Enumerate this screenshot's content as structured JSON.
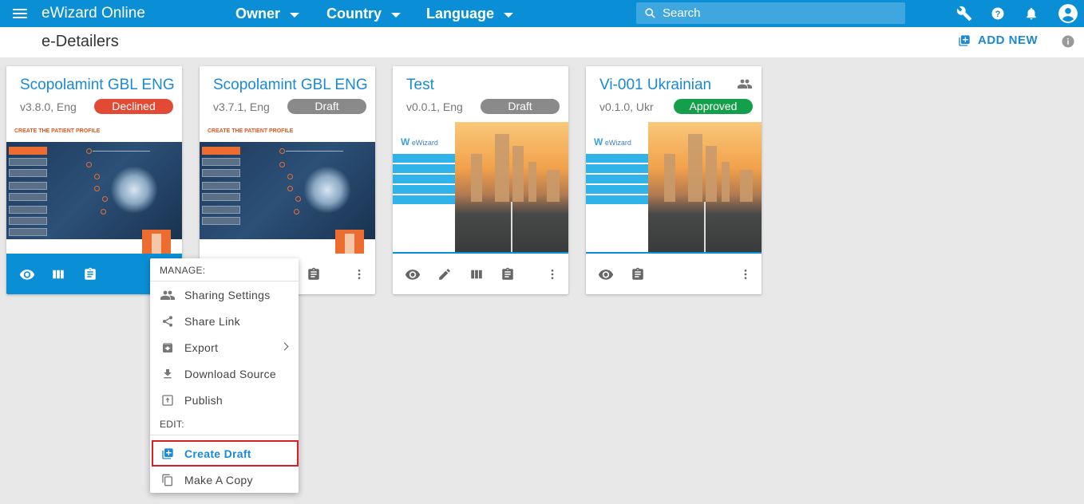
{
  "app": {
    "title": "eWizard Online",
    "filters": [
      {
        "label": "Owner"
      },
      {
        "label": "Country"
      },
      {
        "label": "Language"
      }
    ],
    "search_placeholder": "Search",
    "accent_color": "#0a8fd6"
  },
  "subheader": {
    "title": "e-Detailers",
    "add_new_label": "ADD NEW"
  },
  "cards": [
    {
      "title": "Scopolamint GBL ENG",
      "meta": "v3.8.0,  Eng",
      "status": "Declined",
      "status_color": "#e24a35",
      "thumb_header": "CREATE THE PATIENT PROFILE"
    },
    {
      "title": "Scopolamint GBL ENG",
      "meta": "v3.7.1,  Eng",
      "status": "Draft",
      "status_color": "#8a8a8a",
      "thumb_header": "CREATE THE PATIENT PROFILE"
    },
    {
      "title": "Test",
      "meta": "v0.0.1,  Eng",
      "status": "Draft",
      "status_color": "#8a8a8a",
      "thumb_logo": "eWizard"
    },
    {
      "title": "Vi-001 Ukrainian",
      "meta": "v0.1.0,  Ukr",
      "status": "Approved",
      "status_color": "#14a04a",
      "thumb_logo": "eWizard"
    }
  ],
  "context_menu": {
    "manage_label": "MANAGE:",
    "edit_label": "EDIT:",
    "items": [
      {
        "label": "Sharing Settings",
        "icon": "people-icon"
      },
      {
        "label": "Share Link",
        "icon": "share-icon"
      },
      {
        "label": "Export",
        "icon": "archive-icon"
      },
      {
        "label": "Download Source",
        "icon": "download-icon"
      },
      {
        "label": "Publish",
        "icon": "publish-icon"
      },
      {
        "label": "Create Draft",
        "icon": "library-add-icon"
      },
      {
        "label": "Make A Copy",
        "icon": "copy-icon"
      }
    ]
  }
}
